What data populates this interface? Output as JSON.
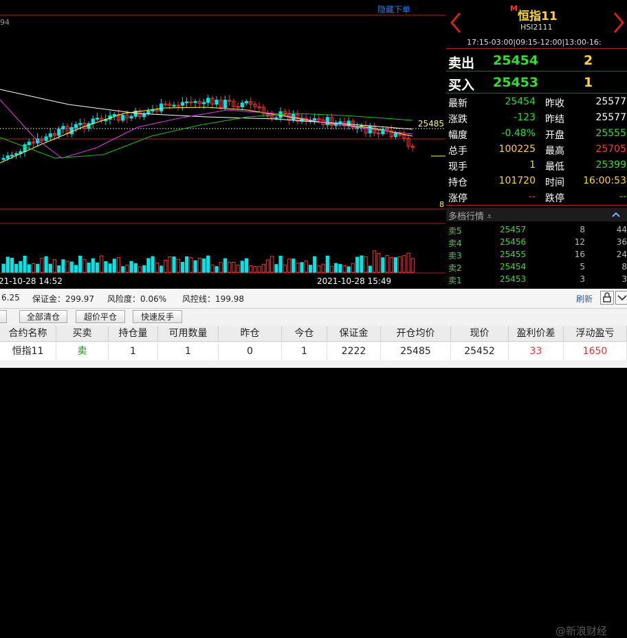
{
  "chart": {
    "hide_order_label": "隐藏下单",
    "top_left_value": "94",
    "price_level_label": "25485",
    "volume_label": "8",
    "time_left": "21-10-28 14:52",
    "time_right": "2021-10-28 15:49",
    "colors": {
      "up": "#00e5e5",
      "down": "#ff3030",
      "ma_white": "#ffffff",
      "ma_yellow": "#ffff40",
      "ma_magenta": "#e040e0",
      "ma_green": "#20c020",
      "grid": "#b02020"
    }
  },
  "quote": {
    "title": "恒指11",
    "flag": "M",
    "code": "HSI2111",
    "hours": "17:15-03:00|09:15-12:00|13:00-16:",
    "sell": {
      "label": "卖出",
      "price": "25454",
      "qty": "2"
    },
    "buy": {
      "label": "买入",
      "price": "25453",
      "qty": "1"
    },
    "fields": [
      {
        "l1": "最新",
        "v1": "25454",
        "c1": "green",
        "l2": "昨收",
        "v2": "25577",
        "c2": "white"
      },
      {
        "l1": "涨跌",
        "v1": "-123",
        "c1": "green",
        "l2": "昨结",
        "v2": "25577",
        "c2": "white"
      },
      {
        "l1": "幅度",
        "v1": "-0.48%",
        "c1": "green",
        "l2": "开盘",
        "v2": "25555",
        "c2": "green"
      },
      {
        "l1": "总手",
        "v1": "100225",
        "c1": "yellow",
        "l2": "最高",
        "v2": "25705",
        "c2": "red"
      },
      {
        "l1": "现手",
        "v1": "1",
        "c1": "yellow",
        "l2": "最低",
        "v2": "25399",
        "c2": "green"
      },
      {
        "l1": "持仓",
        "v1": "101720",
        "c1": "yellow",
        "l2": "时间",
        "v2": "16:00:53",
        "c2": "yellow"
      },
      {
        "l1": "涨停",
        "v1": "--",
        "c1": "red",
        "l2": "跌停",
        "v2": "--",
        "c2": "green"
      }
    ],
    "depth_title": "多档行情",
    "depth": [
      {
        "level": "卖5",
        "price": "25457",
        "qty": "8",
        "count": "44"
      },
      {
        "level": "卖4",
        "price": "25456",
        "qty": "12",
        "count": "36"
      },
      {
        "level": "卖3",
        "price": "25455",
        "qty": "16",
        "count": "24"
      },
      {
        "level": "卖2",
        "price": "25454",
        "qty": "5",
        "count": "8"
      },
      {
        "level": "卖1",
        "price": "25453",
        "qty": "3",
        "count": "3"
      }
    ]
  },
  "status": {
    "first": "6.25",
    "margin": "保证金：299.97",
    "risk": "风险度：0.06%",
    "control": "风控线：199.98",
    "refresh": "刷新"
  },
  "buttons": {
    "close_all": "全部清仓",
    "super_close": "超价平仓",
    "reverse": "快速反手"
  },
  "positions": {
    "headers": [
      "合约名称",
      "买卖",
      "持仓量",
      "可用数量",
      "昨仓",
      "今仓",
      "保证金",
      "开仓均价",
      "现价",
      "盈利价差",
      "浮动盈亏"
    ],
    "row": [
      "恒指11",
      "卖",
      "1",
      "1",
      "0",
      "1",
      "2222",
      "25485",
      "25452",
      "33",
      "1650"
    ]
  },
  "watermark": "@新浪财经"
}
